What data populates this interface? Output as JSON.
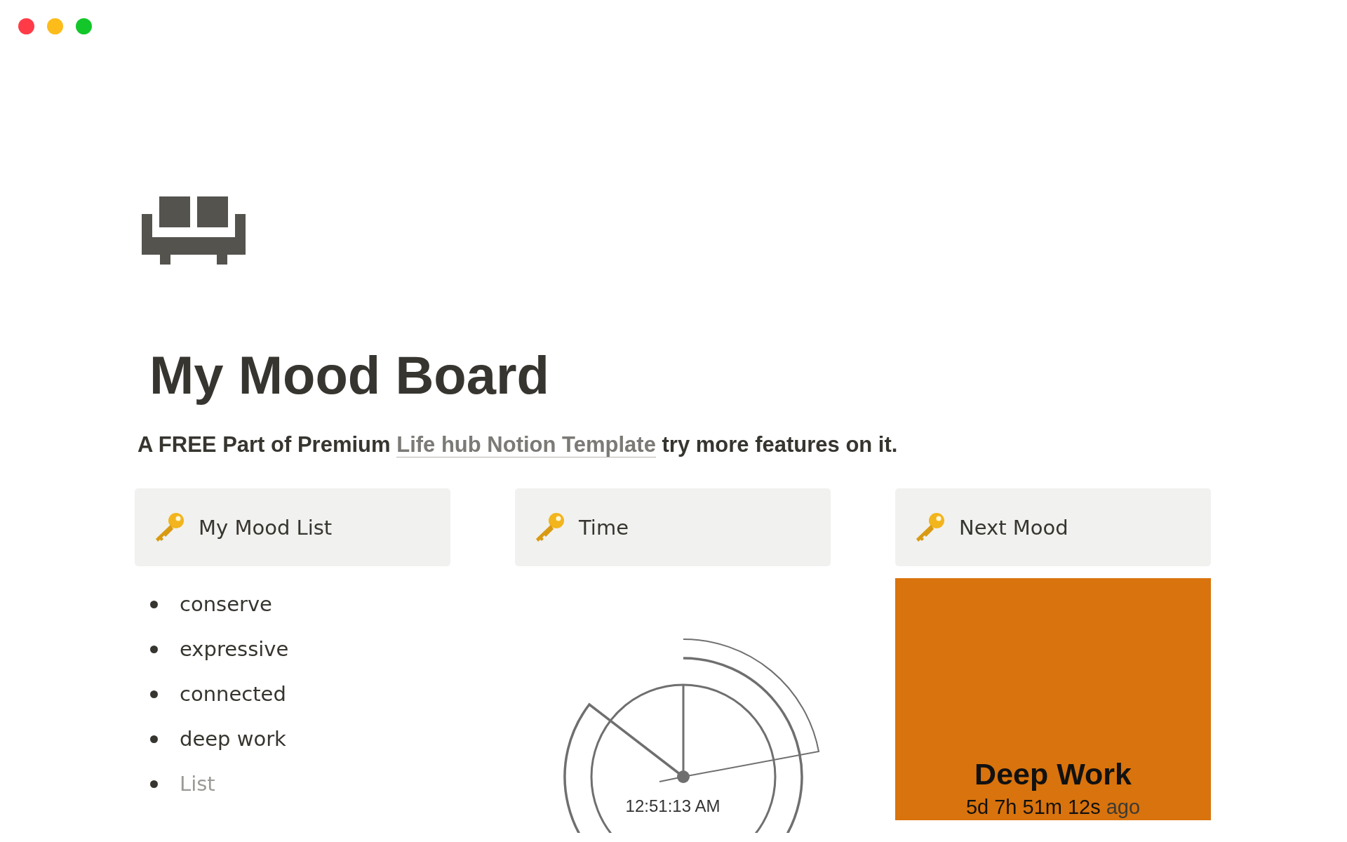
{
  "window": {
    "controls": [
      {
        "kind": "close"
      },
      {
        "kind": "minimize"
      },
      {
        "kind": "zoom"
      }
    ]
  },
  "page": {
    "title": "My Mood Board",
    "subtitle": {
      "before": "A FREE Part of Premium ",
      "link": "Life hub Notion Template",
      "after": " try more features on it."
    }
  },
  "columns": [
    {
      "callout": "My Mood List",
      "kind": "list",
      "items": [
        {
          "text": "conserve",
          "placeholder": false
        },
        {
          "text": "expressive",
          "placeholder": false
        },
        {
          "text": "connected",
          "placeholder": false
        },
        {
          "text": "deep work",
          "placeholder": false
        },
        {
          "text": "List",
          "placeholder": true
        }
      ]
    },
    {
      "callout": "Time",
      "kind": "clock",
      "time": "12:51:13 AM"
    },
    {
      "callout": "Next Mood",
      "kind": "mood",
      "mood": "Deep Work",
      "elapsed": "5d 7h 51m 12s",
      "suffix": "ago",
      "color": "#d9730d"
    }
  ]
}
